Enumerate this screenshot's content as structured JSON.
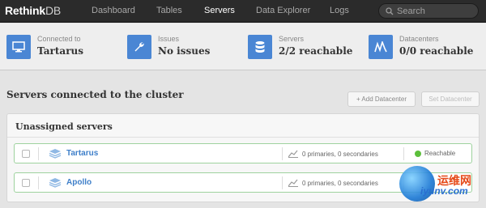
{
  "app": {
    "logo_bold": "Rethink",
    "logo_light": "DB"
  },
  "nav": {
    "items": [
      {
        "label": "Dashboard",
        "active": false
      },
      {
        "label": "Tables",
        "active": false
      },
      {
        "label": "Servers",
        "active": true
      },
      {
        "label": "Data Explorer",
        "active": false
      },
      {
        "label": "Logs",
        "active": false
      }
    ],
    "search_placeholder": "Search"
  },
  "stats": [
    {
      "icon": "monitor-icon",
      "label": "Connected to",
      "value": "Tartarus"
    },
    {
      "icon": "wrench-icon",
      "label": "Issues",
      "value": "No issues"
    },
    {
      "icon": "database-icon",
      "label": "Servers",
      "value": "2/2 reachable"
    },
    {
      "icon": "datacenter-icon",
      "label": "Datacenters",
      "value": "0/0 reachable"
    }
  ],
  "section": {
    "title": "Servers connected to the cluster",
    "add_datacenter": "+ Add Datacenter",
    "set_datacenter": "Set Datacenter"
  },
  "panel": {
    "title": "Unassigned servers",
    "servers": [
      {
        "name": "Tartarus",
        "replicas": "0 primaries, 0 secondaries",
        "status": "Reachable"
      },
      {
        "name": "Apollo",
        "replicas": "0 primaries, 0 secondaries",
        "status": ""
      }
    ]
  },
  "colors": {
    "accent": "#4a86d4",
    "link": "#3e7fc9",
    "reachable": "#5cbf3b",
    "row_border": "#9ed29e"
  },
  "watermark": {
    "line1": "运维网",
    "line2": "iyunv.com"
  }
}
